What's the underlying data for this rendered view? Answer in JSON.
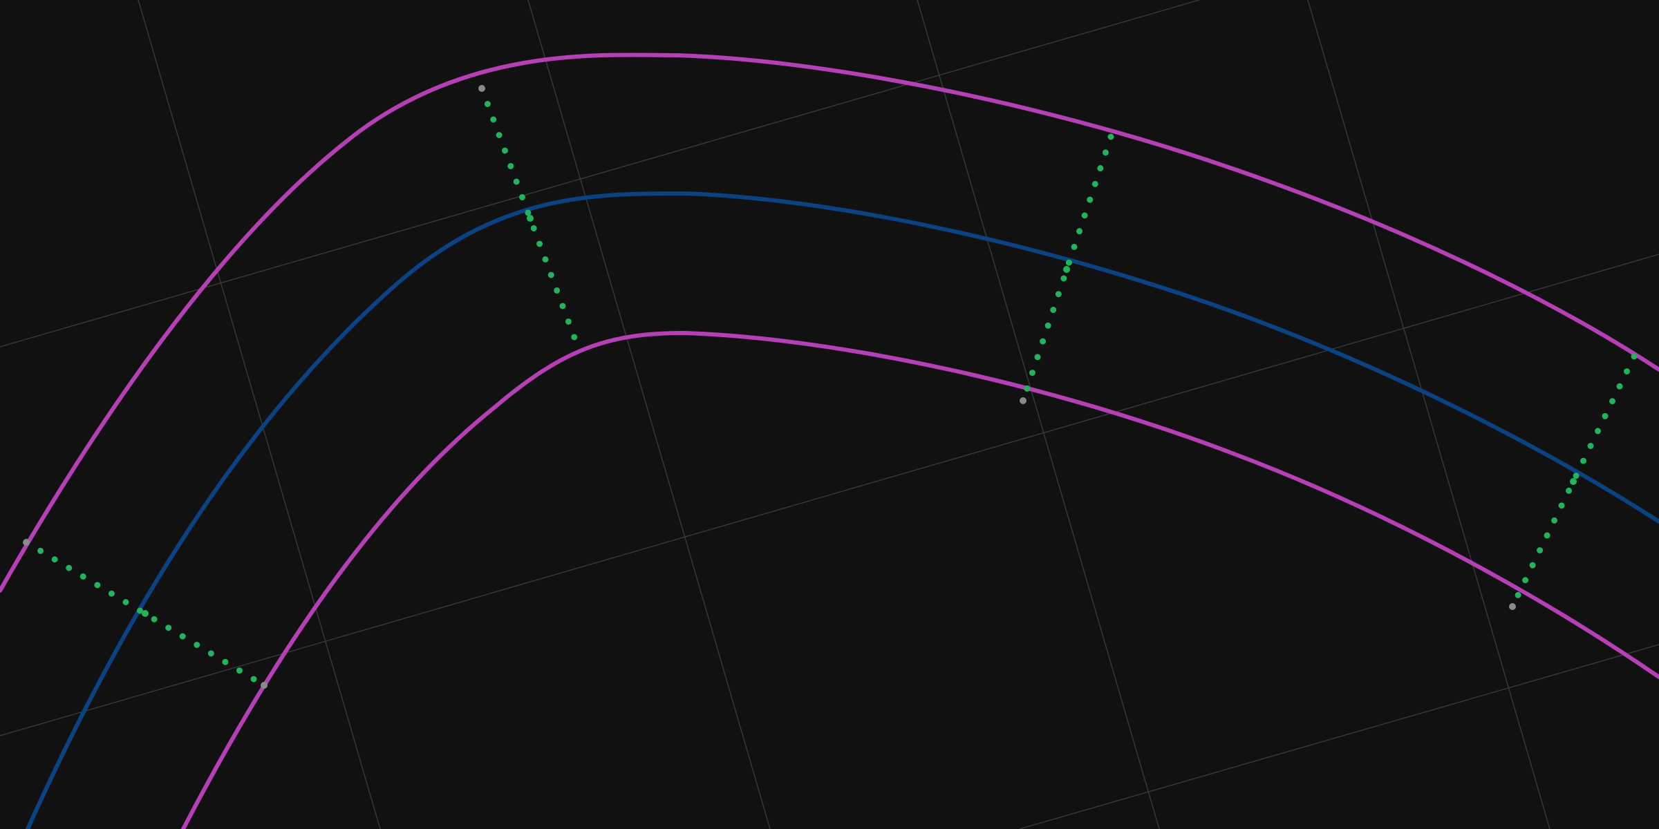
{
  "view": {
    "type": "curved-track-diagram",
    "background_color": "#111112",
    "grid": true,
    "labels_shown": false
  },
  "colors": {
    "grid": "#3a3a3a",
    "outer_boundary": "#b53fb4",
    "inner_boundary": "#b53fb4",
    "centerline": "#0b4282",
    "cross_section_dots": "#22b45a",
    "endpoint_gray": "#8a8a8a"
  },
  "elements": {
    "grid": {
      "name": "reference-grid",
      "style": "thin-gray-lines"
    },
    "outer_boundary": {
      "name": "outer-boundary-curve",
      "style": "solid-magenta"
    },
    "centerline": {
      "name": "centerline-curve",
      "style": "solid-blue"
    },
    "inner_boundary": {
      "name": "inner-boundary-curve",
      "style": "solid-magenta"
    },
    "cross_sections": {
      "name": "dotted-cross-sections",
      "style": "green-dotted-lines",
      "count": 4
    }
  }
}
